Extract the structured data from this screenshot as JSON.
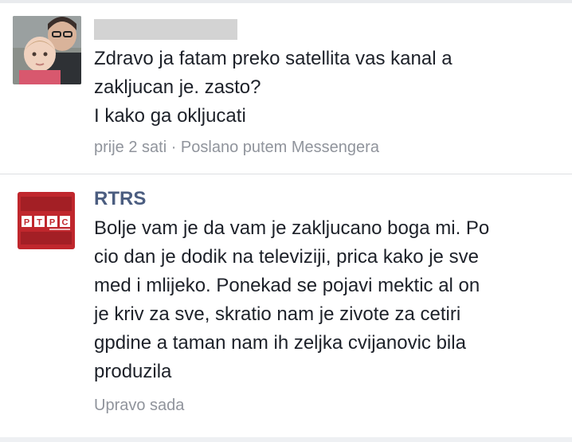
{
  "messages": [
    {
      "sender": "",
      "avatar": "user-photo-avatar",
      "lines": [
        "Zdravo ja fatam preko satellita vas kanal a",
        "zakljucan je. zasto?",
        "I kako ga okljucati"
      ],
      "meta": "prije 2 sati · Poslano putem Messengera"
    },
    {
      "sender": "RTRS",
      "avatar": "rtrs-logo",
      "logo_text": "РТРС",
      "lines": [
        "Bolje vam je da vam je zakljucano boga mi. Po",
        "cio dan je dodik na televiziji, prica kako je sve",
        "med i mlijeko. Ponekad se pojavi mektic al on",
        "je kriv za sve, skratio nam je zivote za cetiri",
        "gpdine a taman nam ih zeljka cvijanovic bila",
        "produzila"
      ],
      "meta": "Upravo sada"
    }
  ],
  "colors": {
    "sender_name": "#4b5d80",
    "body_text": "#1d2129",
    "meta_text": "#90949c",
    "rtrs_red": "#c0272d",
    "separator": "#dddfe2"
  }
}
